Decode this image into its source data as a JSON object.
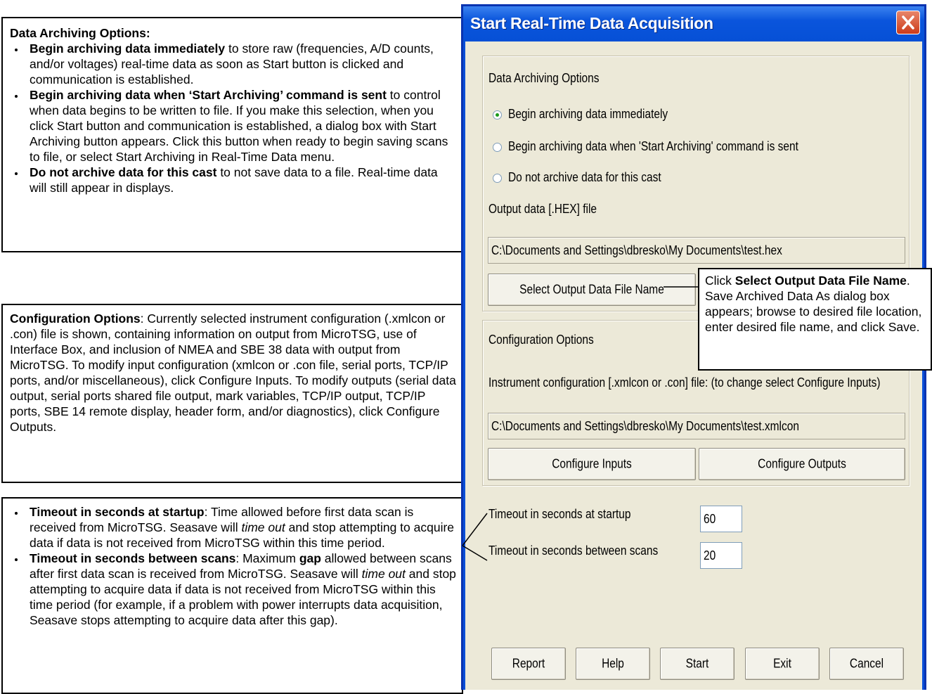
{
  "notes": {
    "archiving": {
      "title": "Data Archiving Options:",
      "items": [
        {
          "bold": "Begin archiving data immediately",
          "text": " to store raw (frequencies, A/D counts, and/or voltages) real-time data as soon as Start button is clicked and communication is established."
        },
        {
          "bold": "Begin archiving data when ‘Start Archiving’ command is sent",
          "text": " to control when data begins to be written to file. If you make this selection, when you click Start button and communication is established, a dialog box with Start Archiving button appears. Click this button when ready to begin saving scans to file, or select Start Archiving in Real-Time Data menu."
        },
        {
          "bold": "Do not archive data for this cast",
          "text": " to not save data to a file. Real-time data will still appear in displays."
        }
      ]
    },
    "configuration": {
      "bold": "Configuration Options",
      "text": ": Currently selected instrument configuration (.xmlcon or .con) file is shown, containing information on output from MicroTSG, use of Interface Box, and inclusion of NMEA and SBE 38 data with output from MicroTSG. To modify input configuration (xmlcon or .con file, serial ports, TCP/IP ports, and/or miscellaneous), click Configure Inputs. To modify outputs (serial data output, serial ports shared file output, mark variables, TCP/IP output, TCP/IP ports, SBE 14 remote display, header form, and/or diagnostics), click Configure Outputs."
    },
    "timeout": {
      "startup_bold": "Timeout in seconds at startup",
      "startup_text_a": ": Time allowed before first data scan is received from MicroTSG. Seasave will ",
      "startup_italic": "time out",
      "startup_text_b": " and stop attempting to acquire data if data is not received from MicroTSG within this time period.",
      "between_bold": "Timeout in seconds between scans",
      "between_text_a": ": Maximum ",
      "between_gap": "gap",
      "between_text_b": " allowed between scans after first data scan is received from MicroTSG. Seasave will ",
      "between_italic": "time out",
      "between_text_c": " and stop attempting to acquire data if data is not received from MicroTSG within this time period (for example, if a problem with power interrupts data acquisition, Seasave stops attempting to acquire data after this gap)."
    },
    "callout": {
      "pre": "Click ",
      "bold": "Select Output Data File Name",
      "post": ". Save Archived Data As dialog box appears; browse to desired file location, enter desired file name, and click Save."
    }
  },
  "dialog": {
    "title": "Start Real-Time Data Acquisition",
    "close_icon": "close-x-icon",
    "archiving": {
      "group_label": "Data Archiving Options",
      "options": [
        {
          "label": "Begin archiving data immediately",
          "checked": true
        },
        {
          "label": "Begin archiving data when 'Start Archiving' command is sent",
          "checked": false
        },
        {
          "label": "Do not archive data for this cast",
          "checked": false
        }
      ],
      "output_label": "Output data [.HEX] file",
      "output_path": "C:\\Documents and Settings\\dbresko\\My Documents\\test.hex",
      "select_button": "Select Output Data File Name"
    },
    "configuration": {
      "group_label": "Configuration Options",
      "config_label": "Instrument configuration [.xmlcon or .con] file: (to change select Configure Inputs)",
      "config_path": "C:\\Documents and Settings\\dbresko\\My Documents\\test.xmlcon",
      "inputs_button": "Configure Inputs",
      "outputs_button": "Configure Outputs"
    },
    "timeouts": {
      "startup_label": "Timeout in seconds at startup",
      "startup_value": "60",
      "between_label": "Timeout in seconds between scans",
      "between_value": "20"
    },
    "buttons": {
      "report": "Report",
      "help": "Help",
      "start": "Start",
      "exit": "Exit",
      "cancel": "Cancel"
    }
  },
  "colors": {
    "titlebar": "#0a55dc",
    "dialog_face": "#ece9d8",
    "close_button": "#cc3b1a",
    "radio_dot": "#1b9a1b"
  }
}
